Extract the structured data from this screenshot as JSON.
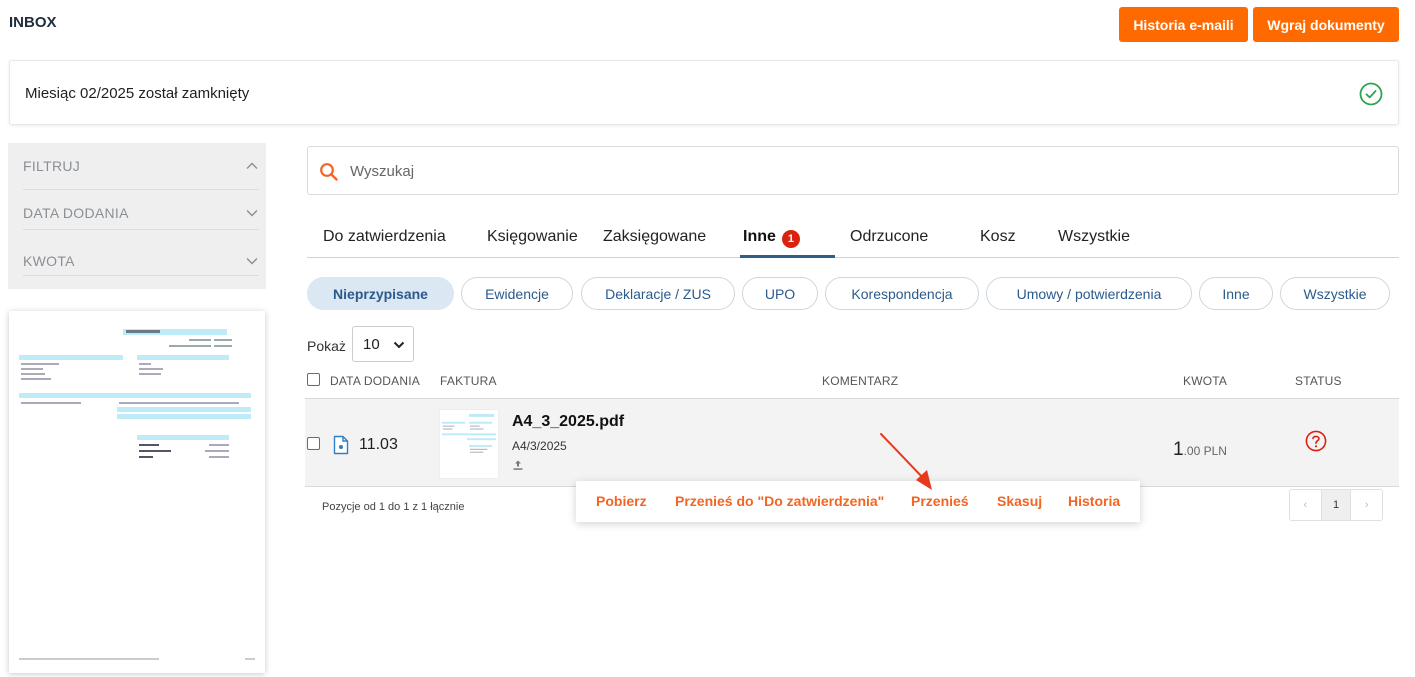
{
  "header": {
    "title": "INBOX",
    "email_history_label": "Historia e-maili",
    "upload_label": "Wgraj dokumenty"
  },
  "notice": {
    "text": "Miesiąc 02/2025 został zamknięty",
    "icon": "check-circle-icon"
  },
  "filters": {
    "items": [
      {
        "label": "FILTRUJ",
        "icon": "chevron-up-icon"
      },
      {
        "label": "DATA DODANIA",
        "icon": "chevron-down-icon"
      },
      {
        "label": "KWOTA",
        "icon": "chevron-down-icon"
      }
    ]
  },
  "search": {
    "placeholder": "Wyszukaj",
    "icon": "search-icon"
  },
  "tabs": [
    {
      "label": "Do zatwierdzenia"
    },
    {
      "label": "Księgowanie"
    },
    {
      "label": "Zaksięgowane"
    },
    {
      "label": "Inne",
      "badge": "1",
      "active": true
    },
    {
      "label": "Odrzucone"
    },
    {
      "label": "Kosz"
    },
    {
      "label": "Wszystkie"
    }
  ],
  "pills": [
    {
      "label": "Nieprzypisane",
      "active": true
    },
    {
      "label": "Ewidencje"
    },
    {
      "label": "Deklaracje / ZUS"
    },
    {
      "label": "UPO"
    },
    {
      "label": "Korespondencja"
    },
    {
      "label": "Umowy / potwierdzenia"
    },
    {
      "label": "Inne"
    },
    {
      "label": "Wszystkie"
    }
  ],
  "page_size": {
    "label": "Pokaż",
    "value": "10"
  },
  "table": {
    "columns": [
      "DATA DODANIA",
      "FAKTURA",
      "KOMENTARZ",
      "KWOTA",
      "STATUS"
    ],
    "rows": [
      {
        "date": "11.03",
        "filename": "A4_3_2025.pdf",
        "doc_number": "A4/3/2025",
        "amount_int": "1",
        "amount_dec": ".00 PLN",
        "status_icon": "question-circle-icon"
      }
    ]
  },
  "footer": {
    "range_text": "Pozycje od 1 do 1 z 1 łącznie",
    "current_page": "1",
    "prev": "‹",
    "next": "›"
  },
  "actions": [
    "Pobierz",
    "Przenieś do \"Do zatwierdzenia\"",
    "Przenieś",
    "Skasuj",
    "Historia"
  ],
  "colors": {
    "accent_orange": "#ff6a00",
    "action_orange": "#f26522",
    "link_blue": "#2b5a8c",
    "badge_red": "#d9230f",
    "success_green": "#2ea44f"
  }
}
